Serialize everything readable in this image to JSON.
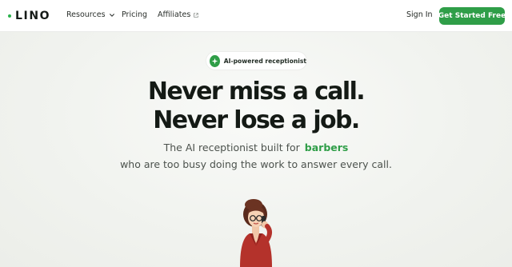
{
  "brand": {
    "name": "LINO",
    "accent": "#2f9e48"
  },
  "nav": {
    "items": [
      {
        "label": "Resources",
        "icon": "chevron-down-icon"
      },
      {
        "label": "Pricing"
      },
      {
        "label": "Affiliates",
        "icon": "external-link-icon"
      }
    ],
    "signin_label": "Sign In",
    "cta_label": "Get Started Free"
  },
  "hero": {
    "badge": {
      "label": "AI-powered receptionist",
      "icon": "sparkle-icon"
    },
    "headline_line1": "Never miss a call.",
    "headline_line2": "Never lose a job.",
    "subtitle_prefix": "The AI receptionist built for",
    "subtitle_highlight": "barbers",
    "subtitle_line2": "who are too busy doing the work to answer every call."
  }
}
